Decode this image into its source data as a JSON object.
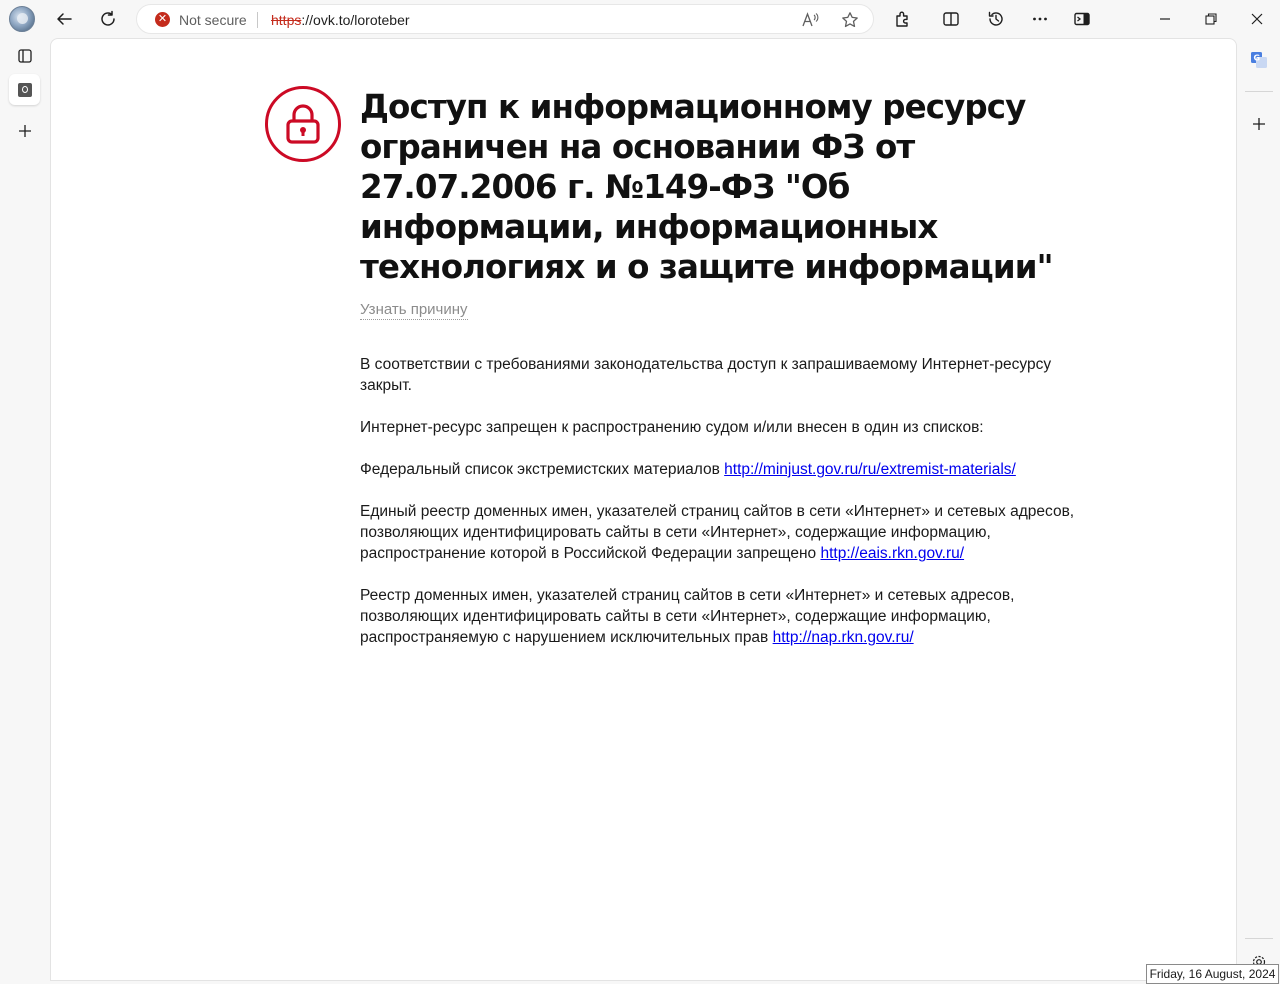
{
  "browser": {
    "security_label": "Not secure",
    "url_protocol": "https",
    "url_rest": "://ovk.to/loroteber",
    "icons": {
      "profile": "profile-avatar",
      "back": "back-arrow-icon",
      "refresh": "refresh-icon",
      "read_aloud": "read-aloud-icon",
      "favorite": "star-icon",
      "extensions": "puzzle-icon",
      "split_screen": "split-screen-icon",
      "history": "history-icon",
      "more": "more-icon",
      "sidebar_toggle": "sidebar-toggle-icon",
      "minimize": "minimize-icon",
      "restore": "restore-icon",
      "close": "close-icon"
    }
  },
  "page": {
    "heading": "Доступ к информационному ресурсу ограничен на основании ФЗ от 27.07.2006 г. №149-ФЗ \"Об информации, информационных технологиях и о защите информации\"",
    "reason_link": "Узнать причину",
    "para1": "В соответствии с требованиями законодательства доступ к запрашиваемому Интернет-ресурсу закрыт.",
    "para2": "Интернет-ресурс запрещен к распространению судом и/или внесен в один из списков:",
    "para3_text": "Федеральный список экстремистских материалов ",
    "para3_link": "http://minjust.gov.ru/ru/extremist-materials/",
    "para4_text": "Единый реестр доменных имен, указателей страниц сайтов в сети «Интернет» и сетевых адресов, позволяющих идентифицировать сайты в сети «Интернет», содержащие информацию, распространение которой в Российской Федерации запрещено ",
    "para4_link": "http://eais.rkn.gov.ru/",
    "para5_text": "Реестр доменных имен, указателей страниц сайтов в сети «Интернет» и сетевых адресов, позволяющих идентифицировать сайты в сети «Интернет», содержащие информацию, распространяемую с нарушением исключительных прав ",
    "para5_link": "http://nap.rkn.gov.ru/"
  },
  "status": {
    "date": "Friday, 16 August, 2024"
  },
  "colors": {
    "accent_red": "#cc0a25",
    "link": "#0000ee",
    "not_secure": "#c42b1c"
  }
}
